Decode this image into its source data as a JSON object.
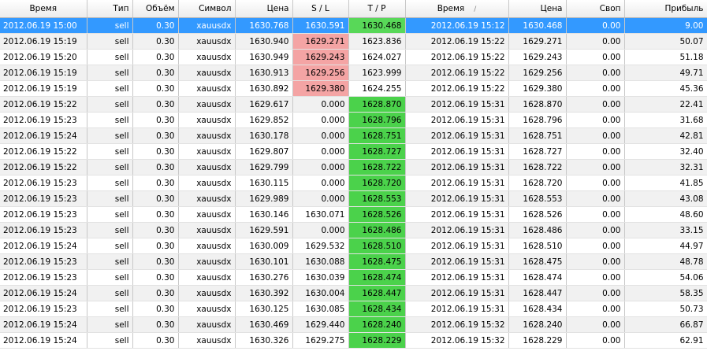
{
  "columns": [
    {
      "key": "open_time",
      "label": "Время",
      "align": "center"
    },
    {
      "key": "type",
      "label": "Тип",
      "align": "right"
    },
    {
      "key": "volume",
      "label": "Объём",
      "align": "right"
    },
    {
      "key": "symbol",
      "label": "Символ",
      "align": "right"
    },
    {
      "key": "open_price",
      "label": "Цена",
      "align": "right"
    },
    {
      "key": "sl",
      "label": "S / L",
      "align": "center"
    },
    {
      "key": "tp",
      "label": "T / P",
      "align": "center"
    },
    {
      "key": "close_time",
      "label": "Время",
      "align": "center",
      "sorted": true
    },
    {
      "key": "close_price",
      "label": "Цена",
      "align": "right"
    },
    {
      "key": "swap",
      "label": "Своп",
      "align": "right"
    },
    {
      "key": "profit",
      "label": "Прибыль",
      "align": "right"
    }
  ],
  "sort_indicator": "/",
  "colors": {
    "selection": "#3399ff",
    "sl_hit": "#f4a4a4",
    "tp_hit": "#4bd24b",
    "alt_row": "#f1f1f1"
  },
  "rows": [
    {
      "open_time": "2012.06.19 15:00",
      "type": "sell",
      "volume": "0.30",
      "symbol": "xauusdx",
      "open_price": "1630.768",
      "sl": "1630.591",
      "tp": "1630.468",
      "close_time": "2012.06.19 15:12",
      "close_price": "1630.468",
      "swap": "0.00",
      "profit": "9.00",
      "hit": "tp",
      "selected": true
    },
    {
      "open_time": "2012.06.19 15:19",
      "type": "sell",
      "volume": "0.30",
      "symbol": "xauusdx",
      "open_price": "1630.940",
      "sl": "1629.271",
      "tp": "1623.836",
      "close_time": "2012.06.19 15:22",
      "close_price": "1629.271",
      "swap": "0.00",
      "profit": "50.07",
      "hit": "sl"
    },
    {
      "open_time": "2012.06.19 15:20",
      "type": "sell",
      "volume": "0.30",
      "symbol": "xauusdx",
      "open_price": "1630.949",
      "sl": "1629.243",
      "tp": "1624.027",
      "close_time": "2012.06.19 15:22",
      "close_price": "1629.243",
      "swap": "0.00",
      "profit": "51.18",
      "hit": "sl"
    },
    {
      "open_time": "2012.06.19 15:19",
      "type": "sell",
      "volume": "0.30",
      "symbol": "xauusdx",
      "open_price": "1630.913",
      "sl": "1629.256",
      "tp": "1623.999",
      "close_time": "2012.06.19 15:22",
      "close_price": "1629.256",
      "swap": "0.00",
      "profit": "49.71",
      "hit": "sl"
    },
    {
      "open_time": "2012.06.19 15:19",
      "type": "sell",
      "volume": "0.30",
      "symbol": "xauusdx",
      "open_price": "1630.892",
      "sl": "1629.380",
      "tp": "1624.255",
      "close_time": "2012.06.19 15:22",
      "close_price": "1629.380",
      "swap": "0.00",
      "profit": "45.36",
      "hit": "sl"
    },
    {
      "open_time": "2012.06.19 15:22",
      "type": "sell",
      "volume": "0.30",
      "symbol": "xauusdx",
      "open_price": "1629.617",
      "sl": "0.000",
      "tp": "1628.870",
      "close_time": "2012.06.19 15:31",
      "close_price": "1628.870",
      "swap": "0.00",
      "profit": "22.41",
      "hit": "tp"
    },
    {
      "open_time": "2012.06.19 15:23",
      "type": "sell",
      "volume": "0.30",
      "symbol": "xauusdx",
      "open_price": "1629.852",
      "sl": "0.000",
      "tp": "1628.796",
      "close_time": "2012.06.19 15:31",
      "close_price": "1628.796",
      "swap": "0.00",
      "profit": "31.68",
      "hit": "tp"
    },
    {
      "open_time": "2012.06.19 15:24",
      "type": "sell",
      "volume": "0.30",
      "symbol": "xauusdx",
      "open_price": "1630.178",
      "sl": "0.000",
      "tp": "1628.751",
      "close_time": "2012.06.19 15:31",
      "close_price": "1628.751",
      "swap": "0.00",
      "profit": "42.81",
      "hit": "tp"
    },
    {
      "open_time": "2012.06.19 15:22",
      "type": "sell",
      "volume": "0.30",
      "symbol": "xauusdx",
      "open_price": "1629.807",
      "sl": "0.000",
      "tp": "1628.727",
      "close_time": "2012.06.19 15:31",
      "close_price": "1628.727",
      "swap": "0.00",
      "profit": "32.40",
      "hit": "tp"
    },
    {
      "open_time": "2012.06.19 15:22",
      "type": "sell",
      "volume": "0.30",
      "symbol": "xauusdx",
      "open_price": "1629.799",
      "sl": "0.000",
      "tp": "1628.722",
      "close_time": "2012.06.19 15:31",
      "close_price": "1628.722",
      "swap": "0.00",
      "profit": "32.31",
      "hit": "tp"
    },
    {
      "open_time": "2012.06.19 15:23",
      "type": "sell",
      "volume": "0.30",
      "symbol": "xauusdx",
      "open_price": "1630.115",
      "sl": "0.000",
      "tp": "1628.720",
      "close_time": "2012.06.19 15:31",
      "close_price": "1628.720",
      "swap": "0.00",
      "profit": "41.85",
      "hit": "tp"
    },
    {
      "open_time": "2012.06.19 15:23",
      "type": "sell",
      "volume": "0.30",
      "symbol": "xauusdx",
      "open_price": "1629.989",
      "sl": "0.000",
      "tp": "1628.553",
      "close_time": "2012.06.19 15:31",
      "close_price": "1628.553",
      "swap": "0.00",
      "profit": "43.08",
      "hit": "tp"
    },
    {
      "open_time": "2012.06.19 15:23",
      "type": "sell",
      "volume": "0.30",
      "symbol": "xauusdx",
      "open_price": "1630.146",
      "sl": "1630.071",
      "tp": "1628.526",
      "close_time": "2012.06.19 15:31",
      "close_price": "1628.526",
      "swap": "0.00",
      "profit": "48.60",
      "hit": "tp"
    },
    {
      "open_time": "2012.06.19 15:23",
      "type": "sell",
      "volume": "0.30",
      "symbol": "xauusdx",
      "open_price": "1629.591",
      "sl": "0.000",
      "tp": "1628.486",
      "close_time": "2012.06.19 15:31",
      "close_price": "1628.486",
      "swap": "0.00",
      "profit": "33.15",
      "hit": "tp"
    },
    {
      "open_time": "2012.06.19 15:24",
      "type": "sell",
      "volume": "0.30",
      "symbol": "xauusdx",
      "open_price": "1630.009",
      "sl": "1629.532",
      "tp": "1628.510",
      "close_time": "2012.06.19 15:31",
      "close_price": "1628.510",
      "swap": "0.00",
      "profit": "44.97",
      "hit": "tp"
    },
    {
      "open_time": "2012.06.19 15:23",
      "type": "sell",
      "volume": "0.30",
      "symbol": "xauusdx",
      "open_price": "1630.101",
      "sl": "1630.088",
      "tp": "1628.475",
      "close_time": "2012.06.19 15:31",
      "close_price": "1628.475",
      "swap": "0.00",
      "profit": "48.78",
      "hit": "tp"
    },
    {
      "open_time": "2012.06.19 15:23",
      "type": "sell",
      "volume": "0.30",
      "symbol": "xauusdx",
      "open_price": "1630.276",
      "sl": "1630.039",
      "tp": "1628.474",
      "close_time": "2012.06.19 15:31",
      "close_price": "1628.474",
      "swap": "0.00",
      "profit": "54.06",
      "hit": "tp"
    },
    {
      "open_time": "2012.06.19 15:24",
      "type": "sell",
      "volume": "0.30",
      "symbol": "xauusdx",
      "open_price": "1630.392",
      "sl": "1630.004",
      "tp": "1628.447",
      "close_time": "2012.06.19 15:31",
      "close_price": "1628.447",
      "swap": "0.00",
      "profit": "58.35",
      "hit": "tp"
    },
    {
      "open_time": "2012.06.19 15:23",
      "type": "sell",
      "volume": "0.30",
      "symbol": "xauusdx",
      "open_price": "1630.125",
      "sl": "1630.085",
      "tp": "1628.434",
      "close_time": "2012.06.19 15:31",
      "close_price": "1628.434",
      "swap": "0.00",
      "profit": "50.73",
      "hit": "tp"
    },
    {
      "open_time": "2012.06.19 15:24",
      "type": "sell",
      "volume": "0.30",
      "symbol": "xauusdx",
      "open_price": "1630.469",
      "sl": "1629.440",
      "tp": "1628.240",
      "close_time": "2012.06.19 15:32",
      "close_price": "1628.240",
      "swap": "0.00",
      "profit": "66.87",
      "hit": "tp"
    },
    {
      "open_time": "2012.06.19 15:24",
      "type": "sell",
      "volume": "0.30",
      "symbol": "xauusdx",
      "open_price": "1630.326",
      "sl": "1629.275",
      "tp": "1628.229",
      "close_time": "2012.06.19 15:32",
      "close_price": "1628.229",
      "swap": "0.00",
      "profit": "62.91",
      "hit": "tp"
    }
  ]
}
